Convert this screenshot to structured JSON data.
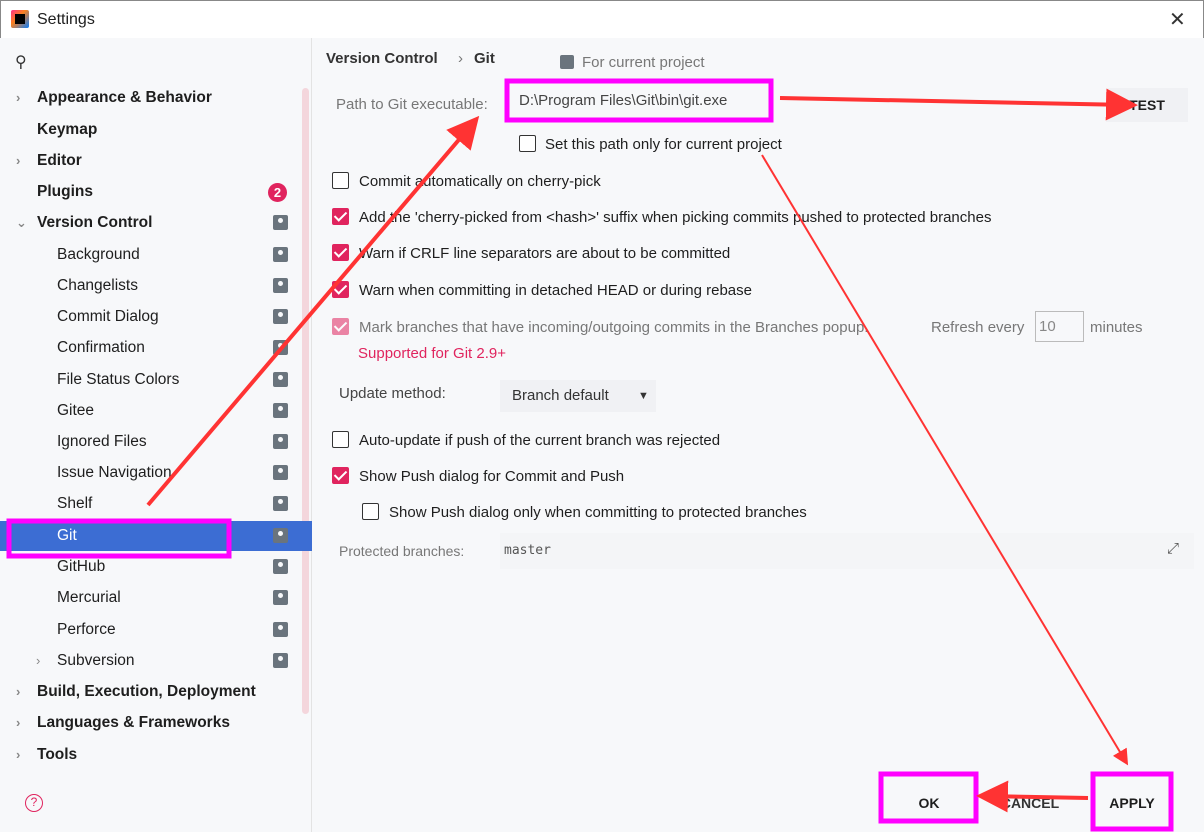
{
  "window": {
    "title": "Settings",
    "close": "✕"
  },
  "sidebar": {
    "items": [
      {
        "label": "Appearance & Behavior",
        "expandable": true,
        "bold": true
      },
      {
        "label": "Keymap",
        "bold": true
      },
      {
        "label": "Editor",
        "expandable": true,
        "bold": true
      },
      {
        "label": "Plugins",
        "bold": true,
        "badge": "2"
      },
      {
        "label": "Version Control",
        "expanded": true,
        "bold": true,
        "project_icon": true
      },
      {
        "label": "Background"
      },
      {
        "label": "Changelists"
      },
      {
        "label": "Commit Dialog"
      },
      {
        "label": "Confirmation"
      },
      {
        "label": "File Status Colors"
      },
      {
        "label": "Gitee"
      },
      {
        "label": "Ignored Files"
      },
      {
        "label": "Issue Navigation"
      },
      {
        "label": "Shelf"
      },
      {
        "label": "Git",
        "selected": true
      },
      {
        "label": "GitHub"
      },
      {
        "label": "Mercurial"
      },
      {
        "label": "Perforce"
      },
      {
        "label": "Subversion",
        "expandable": true
      },
      {
        "label": "Build, Execution, Deployment",
        "expandable": true,
        "bold": true
      },
      {
        "label": "Languages & Frameworks",
        "expandable": true,
        "bold": true
      },
      {
        "label": "Tools",
        "expandable": true,
        "bold": true
      }
    ]
  },
  "breadcrumb": {
    "parent": "Version Control",
    "sep": "›",
    "current": "Git",
    "scope": "For current project"
  },
  "git": {
    "path_label": "Path to Git executable:",
    "path_value": "D:\\Program Files\\Git\\bin\\git.exe",
    "test": "TEST",
    "path_only_project": {
      "label": "Set this path only for current project",
      "checked": false
    },
    "options": [
      {
        "label": "Commit automatically on cherry-pick",
        "checked": false
      },
      {
        "label": "Add the 'cherry-picked from <hash>' suffix when picking commits pushed to protected branches",
        "checked": true
      },
      {
        "label": "Warn if CRLF line separators are about to be committed",
        "checked": true
      },
      {
        "label": "Warn when committing in detached HEAD or during rebase",
        "checked": true
      }
    ],
    "mark": {
      "label": "Mark branches that have incoming/outgoing commits in the Branches popup.",
      "refresh_label": "Refresh every",
      "refresh_value": "10",
      "minutes": "minutes",
      "checked": true,
      "disabled": true,
      "note": "Supported for Git 2.9+"
    },
    "update_label": "Update method:",
    "update_value": "Branch default",
    "auto_update": {
      "label": "Auto-update if push of the current branch was rejected",
      "checked": false
    },
    "show_push": {
      "label": "Show Push dialog for Commit and Push",
      "checked": true
    },
    "show_push_protected": {
      "label": "Show Push dialog only when committing to protected branches",
      "checked": false
    },
    "protected_label": "Protected branches:",
    "protected_value": "master"
  },
  "footer": {
    "ok": "OK",
    "cancel": "CANCEL",
    "apply": "APPLY",
    "help": "?"
  },
  "colors": {
    "accent": "#e0245e",
    "selection": "#3c6dd3",
    "annotation_box": "#ff00ff",
    "annotation_arrow": "#ff3333"
  }
}
